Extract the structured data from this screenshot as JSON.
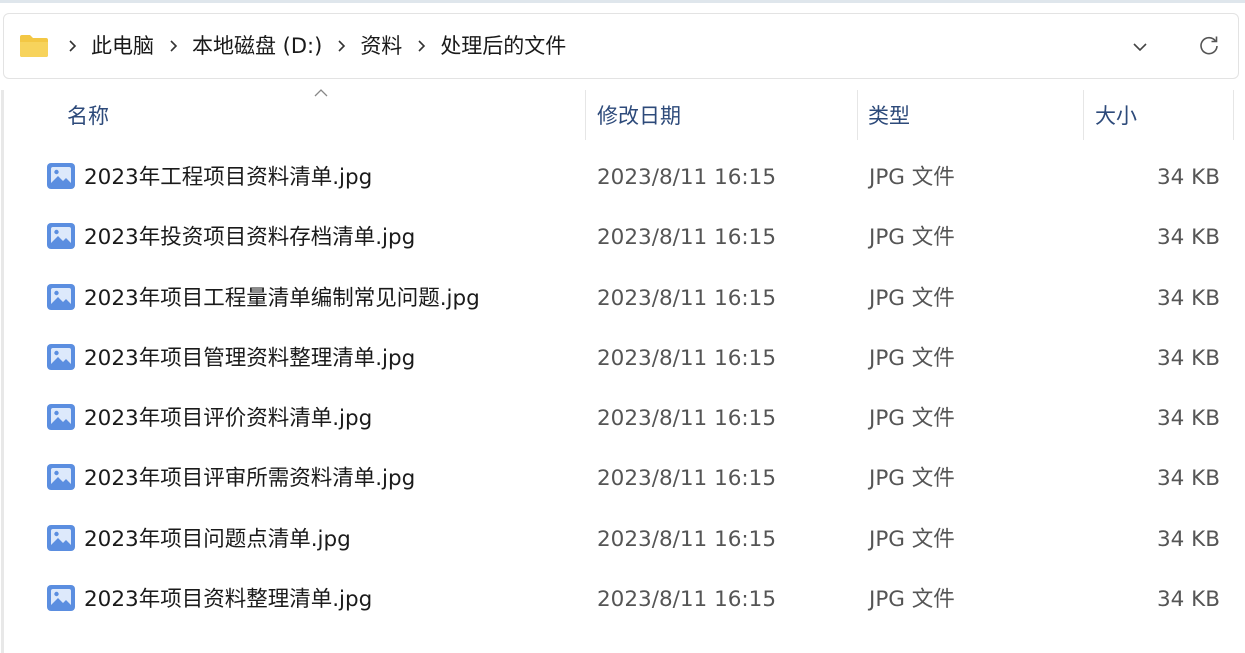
{
  "address_bar": {
    "breadcrumbs": [
      "此电脑",
      "本地磁盘 (D:)",
      "资料",
      "处理后的文件"
    ]
  },
  "columns": {
    "name": "名称",
    "modified": "修改日期",
    "type": "类型",
    "size": "大小"
  },
  "files": [
    {
      "name": "2023年工程项目资料清单.jpg",
      "modified": "2023/8/11 16:15",
      "type": "JPG 文件",
      "size": "34 KB"
    },
    {
      "name": "2023年投资项目资料存档清单.jpg",
      "modified": "2023/8/11 16:15",
      "type": "JPG 文件",
      "size": "34 KB"
    },
    {
      "name": "2023年项目工程量清单编制常见问题.jpg",
      "modified": "2023/8/11 16:15",
      "type": "JPG 文件",
      "size": "34 KB"
    },
    {
      "name": "2023年项目管理资料整理清单.jpg",
      "modified": "2023/8/11 16:15",
      "type": "JPG 文件",
      "size": "34 KB"
    },
    {
      "name": "2023年项目评价资料清单.jpg",
      "modified": "2023/8/11 16:15",
      "type": "JPG 文件",
      "size": "34 KB"
    },
    {
      "name": "2023年项目评审所需资料清单.jpg",
      "modified": "2023/8/11 16:15",
      "type": "JPG 文件",
      "size": "34 KB"
    },
    {
      "name": "2023年项目问题点清单.jpg",
      "modified": "2023/8/11 16:15",
      "type": "JPG 文件",
      "size": "34 KB"
    },
    {
      "name": "2023年项目资料整理清单.jpg",
      "modified": "2023/8/11 16:15",
      "type": "JPG 文件",
      "size": "34 KB"
    }
  ],
  "icons": {
    "folder": "folder-icon",
    "breadcrumb_separator": "chevron-right-icon",
    "address_dropdown": "chevron-down-icon",
    "refresh": "refresh-icon",
    "sort": "sort-ascending-icon",
    "file": "image-file-icon"
  },
  "colors": {
    "folder": "#f3c744",
    "file_icon": "#5b8ee0",
    "header_text": "#2d4a7a"
  }
}
